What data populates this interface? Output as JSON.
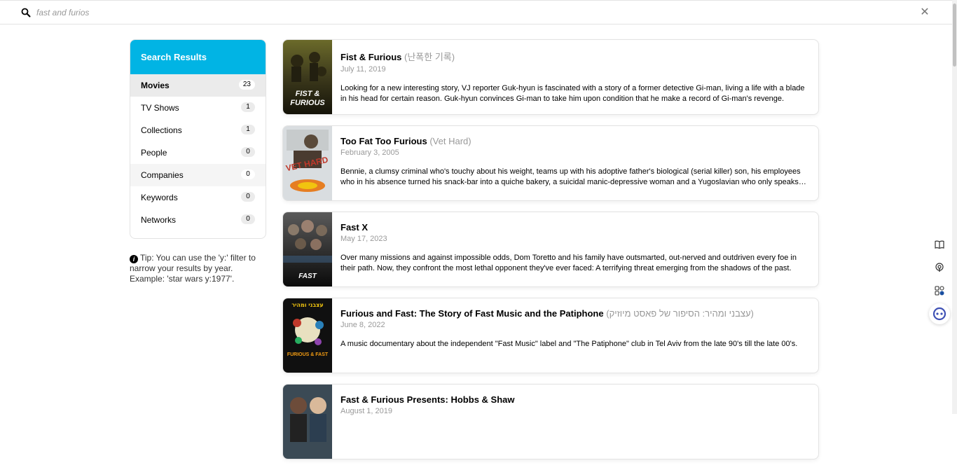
{
  "search": {
    "value": "",
    "placeholder": "fast and furios"
  },
  "sidebar": {
    "title": "Search Results",
    "items": [
      {
        "label": "Movies",
        "count": "23"
      },
      {
        "label": "TV Shows",
        "count": "1"
      },
      {
        "label": "Collections",
        "count": "1"
      },
      {
        "label": "People",
        "count": "0"
      },
      {
        "label": "Companies",
        "count": "0"
      },
      {
        "label": "Keywords",
        "count": "0"
      },
      {
        "label": "Networks",
        "count": "0"
      }
    ]
  },
  "tip": "Tip: You can use the 'y:' filter to narrow your results by year. Example: 'star wars y:1977'.",
  "results": [
    {
      "title": "Fist & Furious",
      "original_title": "(난폭한 기록)",
      "date": "July 11, 2019",
      "overview": "Looking for a new interesting story, VJ reporter Guk-hyun is fascinated with a story of a former detective Gi-man, living a life with a blade in his head for certain reason. Guk-hyun convinces Gi-man to take him upon condition that he make a record of Gi-man's revenge."
    },
    {
      "title": "Too Fat Too Furious",
      "original_title": "(Vet Hard)",
      "date": "February 3, 2005",
      "overview": "Bennie, a clumsy criminal who's touchy about his weight, teams up with his adoptive father's biological (serial killer) son, his employees who in his absence turned his snack-bar into a quiche bakery, a suicidal manic-depressive woman and a Yugoslavian who only speaks his own language."
    },
    {
      "title": "Fast X",
      "original_title": "",
      "date": "May 17, 2023",
      "overview": "Over many missions and against impossible odds, Dom Toretto and his family have outsmarted, out-nerved and outdriven every foe in their path. Now, they confront the most lethal opponent they've ever faced: A terrifying threat emerging from the shadows of the past."
    },
    {
      "title": "Furious and Fast: The Story of Fast Music and the Patiphone",
      "original_title": "(עצבני ומהיר: הסיפור של פאסט מיוזיק)",
      "date": "June 8, 2022",
      "overview": "A music documentary about the independent \"Fast Music\" label and \"The Patiphone\" club in Tel Aviv from the late 90's till the late 00's."
    },
    {
      "title": "Fast & Furious Presents: Hobbs & Shaw",
      "original_title": "",
      "date": "August 1, 2019",
      "overview": ""
    }
  ],
  "posters": [
    {
      "text_line1": "FIST &",
      "text_line2": "FURIOUS"
    },
    {
      "text_line1": "VET HARD",
      "text_line2": ""
    },
    {
      "text_line1": "FAST",
      "text_line2": ""
    },
    {
      "text_line1": "עצבני ומהיר",
      "text_line2": "FURIOUS & FAST"
    },
    {
      "text_line1": "",
      "text_line2": ""
    }
  ],
  "colors": {
    "accent": "#01b4e4",
    "active_item_bg": "#ebebeb"
  },
  "icons": [
    "search-icon",
    "close-icon",
    "info-icon",
    "book-icon",
    "podcast-icon",
    "apps-icon",
    "assistant-icon"
  ]
}
